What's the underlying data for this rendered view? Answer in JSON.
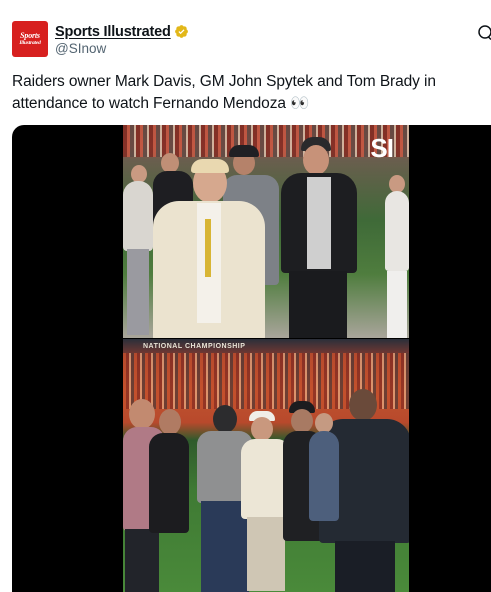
{
  "tweet": {
    "avatar_line1": "Sports",
    "avatar_line2": "Illustrated",
    "display_name": "Sports Illustrated",
    "handle": "@SInow",
    "text": "Raiders owner Mark Davis, GM John Spytek and Tom Brady in attendance to watch Fernando Mendoza 👀"
  },
  "media": {
    "watermark": "SI",
    "banner_text": "NATIONAL CHAMPIONSHIP"
  },
  "icons": {
    "verified": "verified-badge-icon",
    "more": "more-options-icon"
  },
  "colors": {
    "brand_red": "#d7201f",
    "verified_gold": "#e2b719",
    "text_primary": "#0f1419",
    "text_secondary": "#536471"
  }
}
